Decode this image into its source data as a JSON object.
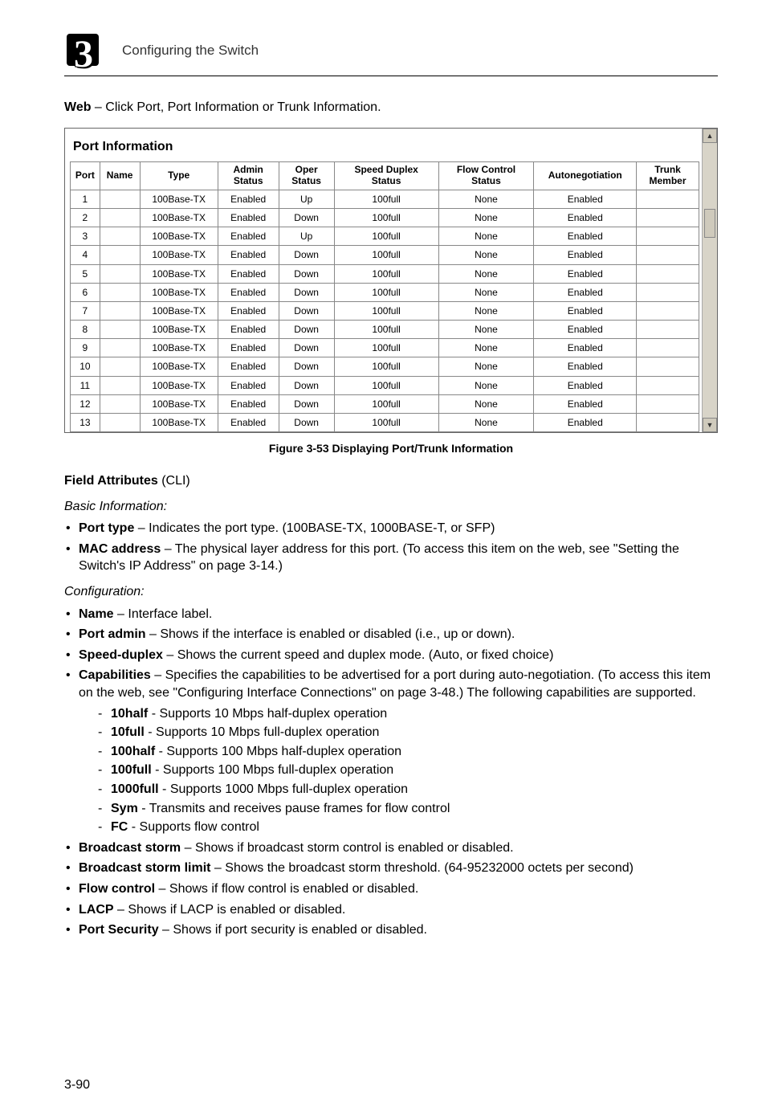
{
  "header": {
    "chapter_digit": "3",
    "chapter_title": "Configuring the Switch"
  },
  "web_line_prefix": "Web",
  "web_line_rest": " – Click Port, Port Information or Trunk Information.",
  "screenshot": {
    "title": "Port Information",
    "columns": [
      "Port",
      "Name",
      "Type",
      "Admin Status",
      "Oper Status",
      "Speed Duplex Status",
      "Flow Control Status",
      "Autonegotiation",
      "Trunk Member"
    ],
    "rows": [
      {
        "port": "1",
        "name": "",
        "type": "100Base-TX",
        "admin": "Enabled",
        "oper": "Up",
        "speed": "100full",
        "flow": "None",
        "auto": "Enabled",
        "trunk": ""
      },
      {
        "port": "2",
        "name": "",
        "type": "100Base-TX",
        "admin": "Enabled",
        "oper": "Down",
        "speed": "100full",
        "flow": "None",
        "auto": "Enabled",
        "trunk": ""
      },
      {
        "port": "3",
        "name": "",
        "type": "100Base-TX",
        "admin": "Enabled",
        "oper": "Up",
        "speed": "100full",
        "flow": "None",
        "auto": "Enabled",
        "trunk": ""
      },
      {
        "port": "4",
        "name": "",
        "type": "100Base-TX",
        "admin": "Enabled",
        "oper": "Down",
        "speed": "100full",
        "flow": "None",
        "auto": "Enabled",
        "trunk": ""
      },
      {
        "port": "5",
        "name": "",
        "type": "100Base-TX",
        "admin": "Enabled",
        "oper": "Down",
        "speed": "100full",
        "flow": "None",
        "auto": "Enabled",
        "trunk": ""
      },
      {
        "port": "6",
        "name": "",
        "type": "100Base-TX",
        "admin": "Enabled",
        "oper": "Down",
        "speed": "100full",
        "flow": "None",
        "auto": "Enabled",
        "trunk": ""
      },
      {
        "port": "7",
        "name": "",
        "type": "100Base-TX",
        "admin": "Enabled",
        "oper": "Down",
        "speed": "100full",
        "flow": "None",
        "auto": "Enabled",
        "trunk": ""
      },
      {
        "port": "8",
        "name": "",
        "type": "100Base-TX",
        "admin": "Enabled",
        "oper": "Down",
        "speed": "100full",
        "flow": "None",
        "auto": "Enabled",
        "trunk": ""
      },
      {
        "port": "9",
        "name": "",
        "type": "100Base-TX",
        "admin": "Enabled",
        "oper": "Down",
        "speed": "100full",
        "flow": "None",
        "auto": "Enabled",
        "trunk": ""
      },
      {
        "port": "10",
        "name": "",
        "type": "100Base-TX",
        "admin": "Enabled",
        "oper": "Down",
        "speed": "100full",
        "flow": "None",
        "auto": "Enabled",
        "trunk": ""
      },
      {
        "port": "11",
        "name": "",
        "type": "100Base-TX",
        "admin": "Enabled",
        "oper": "Down",
        "speed": "100full",
        "flow": "None",
        "auto": "Enabled",
        "trunk": ""
      },
      {
        "port": "12",
        "name": "",
        "type": "100Base-TX",
        "admin": "Enabled",
        "oper": "Down",
        "speed": "100full",
        "flow": "None",
        "auto": "Enabled",
        "trunk": ""
      },
      {
        "port": "13",
        "name": "",
        "type": "100Base-TX",
        "admin": "Enabled",
        "oper": "Down",
        "speed": "100full",
        "flow": "None",
        "auto": "Enabled",
        "trunk": ""
      }
    ]
  },
  "figure_caption": "Figure 3-53  Displaying Port/Trunk Information",
  "field_attributes_heading_bold": "Field Attributes",
  "field_attributes_heading_rest": " (CLI)",
  "basic_info_heading": "Basic Information:",
  "basic_info": [
    {
      "term": "Port type",
      "desc": " – Indicates the port type. (100BASE-TX, 1000BASE-T, or SFP)"
    },
    {
      "term": "MAC address",
      "desc": " – The physical layer address for this port. (To access this item on the web, see \"Setting the Switch's IP Address\" on page 3-14.)"
    }
  ],
  "config_heading": "Configuration:",
  "config": [
    {
      "term": "Name",
      "desc": " – Interface label."
    },
    {
      "term": "Port admin",
      "desc": " – Shows if the interface is enabled or disabled (i.e., up or down)."
    },
    {
      "term": "Speed-duplex",
      "desc": " – Shows the current speed and duplex mode. (Auto, or fixed choice)"
    },
    {
      "term": "Capabilities",
      "desc": " – Specifies the capabilities to be advertised for a port during auto-negotiation. (To access this item on the web, see \"Configuring Interface Connections\" on page 3-48.) The following capabilities are supported.",
      "sub": [
        {
          "t": "10half",
          "d": " - Supports 10 Mbps half-duplex operation"
        },
        {
          "t": "10full",
          "d": " - Supports 10 Mbps full-duplex operation"
        },
        {
          "t": "100half",
          "d": " - Supports 100 Mbps half-duplex operation"
        },
        {
          "t": "100full",
          "d": " - Supports 100 Mbps full-duplex operation"
        },
        {
          "t": "1000full",
          "d": " - Supports 1000 Mbps full-duplex operation"
        },
        {
          "t": "Sym",
          "d": " - Transmits and receives pause frames for flow control"
        },
        {
          "t": "FC",
          "d": " - Supports flow control"
        }
      ]
    },
    {
      "term": "Broadcast storm",
      "desc": " – Shows if broadcast storm control is enabled or disabled."
    },
    {
      "term": "Broadcast storm limit",
      "desc": " – Shows the broadcast storm threshold. (64-95232000 octets per second)"
    },
    {
      "term": "Flow control",
      "desc": " – Shows if flow control is enabled or disabled."
    },
    {
      "term": "LACP",
      "desc": " – Shows if LACP is enabled or disabled."
    },
    {
      "term": "Port Security",
      "desc": " – Shows if port security is enabled or disabled."
    }
  ],
  "page_number": "3-90"
}
